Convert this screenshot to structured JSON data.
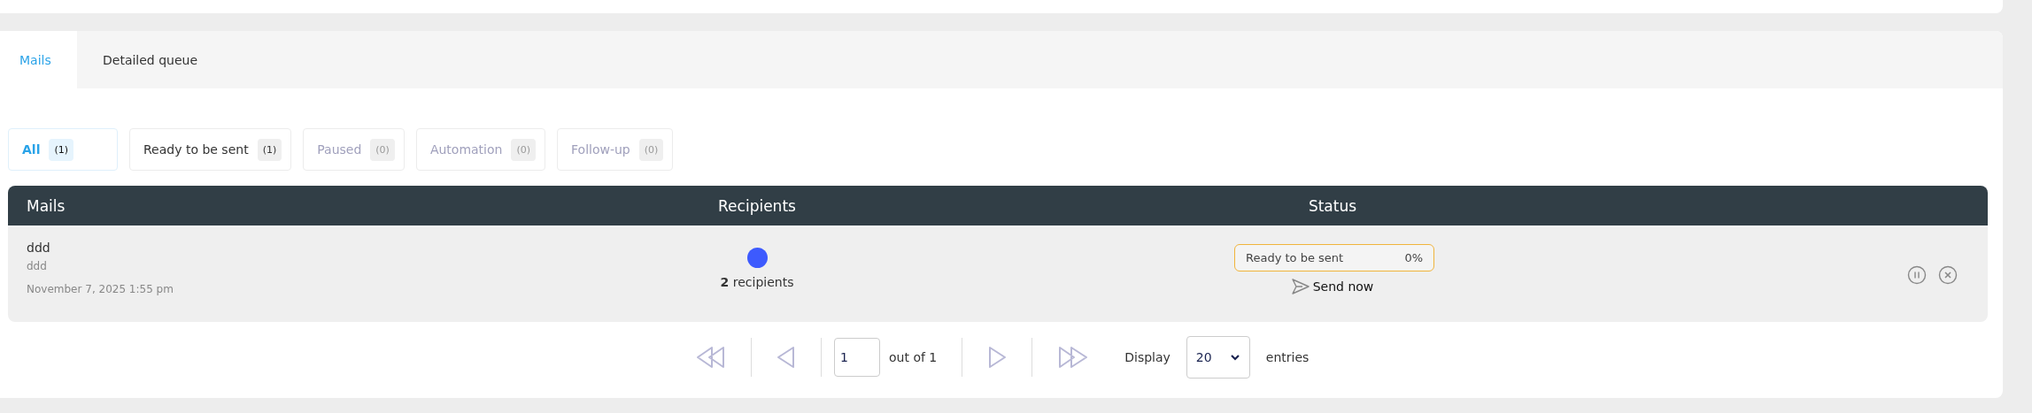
{
  "tabs": [
    {
      "label": "Mails",
      "selected": true
    },
    {
      "label": "Detailed queue",
      "selected": false
    }
  ],
  "filters": [
    {
      "label": "All",
      "count": "(1)",
      "selected": true,
      "disabled": false
    },
    {
      "label": "Ready to be sent",
      "count": "(1)",
      "selected": false,
      "disabled": false
    },
    {
      "label": "Paused",
      "count": "(0)",
      "selected": false,
      "disabled": true
    },
    {
      "label": "Automation",
      "count": "(0)",
      "selected": false,
      "disabled": true
    },
    {
      "label": "Follow-up",
      "count": "(0)",
      "selected": false,
      "disabled": true
    }
  ],
  "table": {
    "columns": [
      "Mails",
      "Recipients",
      "Status"
    ],
    "rows": [
      {
        "title": "ddd",
        "subject": "ddd",
        "date": "November 7, 2025 1:55 pm",
        "recipient_count": "2",
        "recipients_label": "recipients",
        "color": "#3d5afe",
        "status": "Ready to be sent",
        "progress": "0%",
        "action": "Send now"
      }
    ]
  },
  "pagination": {
    "page": "1",
    "out_of": "out of 1",
    "display_label": "Display",
    "per_page": "20",
    "entries_label": "entries"
  }
}
